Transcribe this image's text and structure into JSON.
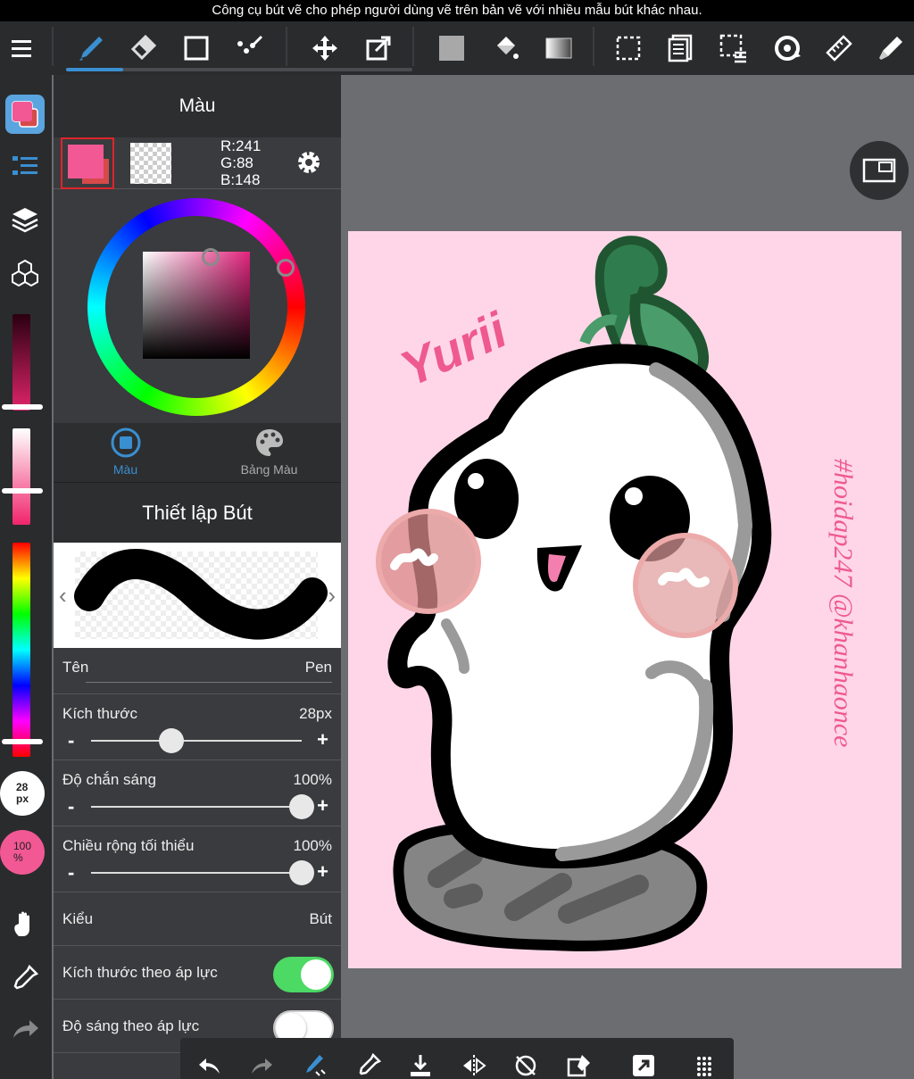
{
  "caption": "Công cụ bút vẽ cho phép người dùng vẽ trên bản vẽ với nhiều mẫu bút khác nhau.",
  "toolbar": {
    "tools": [
      "menu-icon",
      "pen-icon",
      "eraser-icon",
      "rectangle-icon",
      "lasso-icon",
      "move-icon",
      "transform-icon",
      "fill-color-icon",
      "bucket-icon",
      "gradient-icon",
      "select-icon",
      "layer-list-icon",
      "selection-mask-icon",
      "rotate-icon",
      "ruler-icon",
      "fill-pen-icon"
    ]
  },
  "left_strip": {
    "brush_size_badge": "28\npx",
    "opacity_badge": "100\n%"
  },
  "color_panel": {
    "title": "Màu",
    "rgb": {
      "r": "R:241",
      "g": "G:88",
      "b": "B:148"
    },
    "current_color": "#f15894",
    "tabs": [
      {
        "label": "Màu",
        "active": true
      },
      {
        "label": "Bảng Màu",
        "active": false
      }
    ]
  },
  "brush_panel": {
    "title": "Thiết lập Bút",
    "name_label": "Tên",
    "name_value": "Pen",
    "size_label": "Kích thước",
    "size_value": "28px",
    "size_level": 0.38,
    "opacity_label": "Độ chắn sáng",
    "opacity_value": "100%",
    "opacity_level": 1.0,
    "minwidth_label": "Chiều rộng tối thiểu",
    "minwidth_value": "100%",
    "minwidth_level": 1.0,
    "style_label": "Kiểu",
    "style_value": "Bút",
    "pressure_size_label": "Kích thước theo áp lực",
    "pressure_size_on": true,
    "pressure_opacity_label": "Độ sáng theo áp lực",
    "pressure_opacity_on": false,
    "minus": "-",
    "plus": "+"
  },
  "canvas": {
    "title_text": "Yurii",
    "side_text": "#hoidap247 @khanhaonce",
    "background": "#ffd6e8"
  },
  "colors": {
    "accent": "#3a8fd0",
    "toggle_on": "#4cd964",
    "pink": "#f15894"
  }
}
